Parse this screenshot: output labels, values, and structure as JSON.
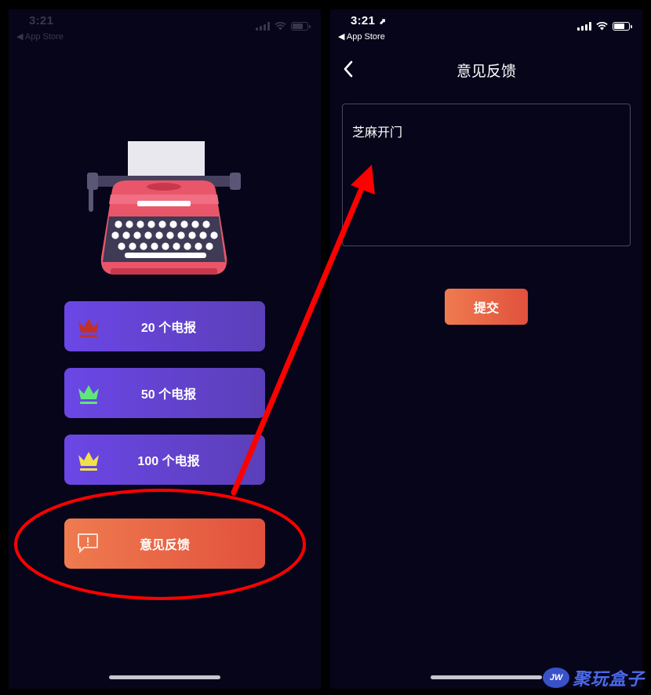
{
  "left_screen": {
    "status": {
      "time": "3:21",
      "back_app": "◀ App Store"
    },
    "options": [
      {
        "label": "20 个电报",
        "crown_color": "#c0312a"
      },
      {
        "label": "50 个电报",
        "crown_color": "#5fe67a"
      },
      {
        "label": "100 个电报",
        "crown_color": "#f2e04b"
      }
    ],
    "feedback_button": {
      "label": "意见反馈",
      "icon": "feedback-alert-icon"
    }
  },
  "right_screen": {
    "status": {
      "time": "3:21",
      "location_arrow": "⬈",
      "back_app": "◀ App Store"
    },
    "nav": {
      "title": "意见反馈",
      "back_icon": "chevron-left-icon"
    },
    "feedback_input": {
      "value": "芝麻开门"
    },
    "submit_button": {
      "label": "提交"
    }
  },
  "annotation": {
    "color": "#ff0000"
  },
  "watermark": {
    "badge": "JW",
    "text": "聚玩盒子"
  },
  "colors": {
    "background": "#06051a",
    "option_gradient": [
      "#6b46e6",
      "#5b3fb8"
    ],
    "accent_gradient": [
      "#ef7b4f",
      "#e1513d"
    ]
  }
}
